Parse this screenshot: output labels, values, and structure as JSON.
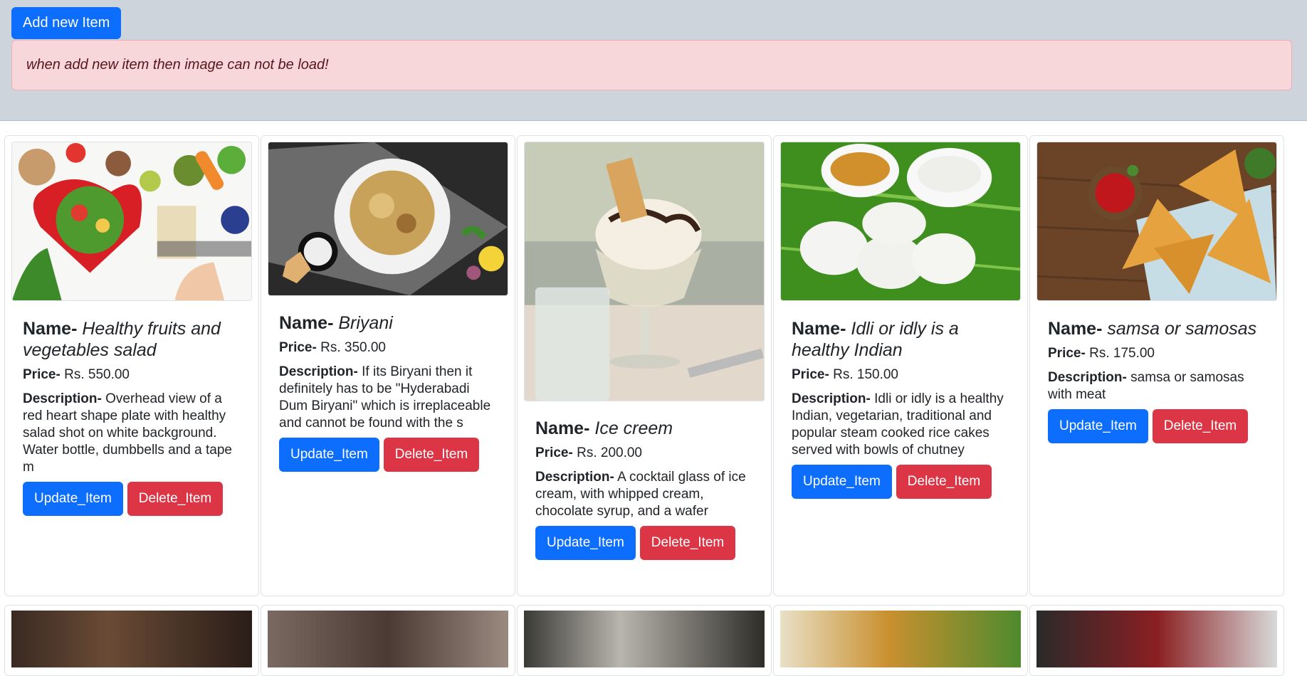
{
  "header": {
    "add_button": "Add new Item",
    "alert_text": "when add new item then image can not be load!"
  },
  "labels": {
    "name": "Name-",
    "price": "Price-",
    "description": "Description-"
  },
  "buttons": {
    "update": "Update_Item",
    "delete": "Delete_Item"
  },
  "cards": [
    {
      "name": "Healthy fruits and vegetables salad",
      "price": "Rs. 550.00",
      "description": "Overhead view of a red heart shape plate with healthy salad shot on white background. Water bottle, dumbbells and a tape m",
      "image_icon": "salad-image"
    },
    {
      "name": "Briyani",
      "price": "Rs. 350.00",
      "description": "If its Biryani then it definitely has to be \"Hyderabadi Dum Biryani\" which is irreplaceable and cannot be found with the s",
      "image_icon": "biryani-image"
    },
    {
      "name": "Ice creem",
      "price": "Rs. 200.00",
      "description": "A cocktail glass of ice cream, with whipped cream, chocolate syrup, and a wafer",
      "image_icon": "ice-cream-image"
    },
    {
      "name": "Idli or idly is a healthy Indian",
      "price": "Rs. 150.00",
      "description": "Idli or idly is a healthy Indian, vegetarian, traditional and popular steam cooked rice cakes served with bowls of chutney",
      "image_icon": "idli-image"
    },
    {
      "name": "samsa or samosas",
      "price": "Rs. 175.00",
      "description": "samsa or samosas with meat",
      "image_icon": "samosa-image"
    }
  ],
  "colors": {
    "primary": "#0d6efd",
    "danger": "#dc3545",
    "alert_bg": "#f8d7da",
    "header_bg": "#ced4dc"
  }
}
